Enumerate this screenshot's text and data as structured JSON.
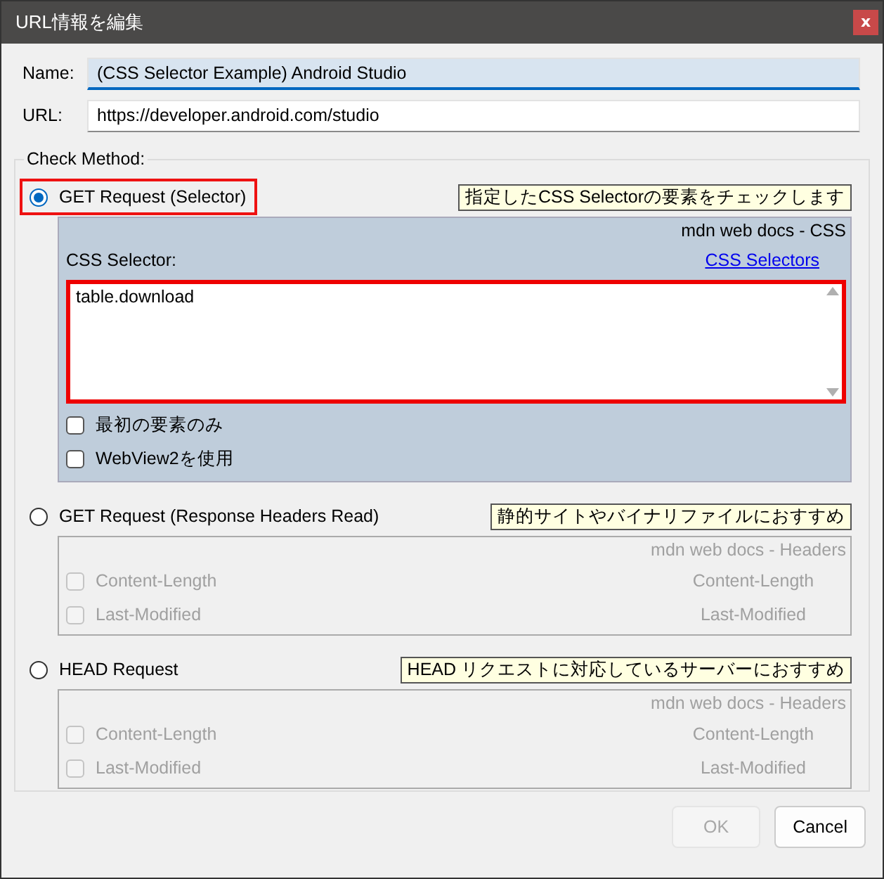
{
  "window": {
    "title": "URL情報を編集",
    "close_button": "x"
  },
  "fields": [
    {
      "label": "Name:",
      "value": "(CSS Selector Example) Android Studio",
      "focused": true
    },
    {
      "label": "URL:",
      "value": "https://developer.android.com/studio",
      "focused": false
    }
  ],
  "check_method": {
    "legend": "Check Method:",
    "methods": [
      {
        "label": "GET Request (Selector)",
        "selected": true,
        "highlighted": true,
        "hint": "指定したCSS Selectorの要素をチェックします",
        "panel": {
          "kind": "selector",
          "enabled": true,
          "caption": "mdn web docs - CSS",
          "selector_label": "CSS Selector:",
          "link": "CSS Selectors",
          "selector": {
            "value": "table.download",
            "highlighted": true
          },
          "options": [
            {
              "label": "最初の要素のみ",
              "checked": false
            },
            {
              "label": "WebView2を使用",
              "checked": false
            }
          ]
        }
      },
      {
        "label": "GET Request (Response Headers Read)",
        "selected": false,
        "highlighted": false,
        "hint": "静的サイトやバイナリファイルにおすすめ",
        "panel": {
          "kind": "headers",
          "enabled": false,
          "caption": "mdn web docs - Headers",
          "options": [
            {
              "label": "Content-Length",
              "checked": false,
              "link": "Content-Length"
            },
            {
              "label": "Last-Modified",
              "checked": false,
              "link": "Last-Modified"
            }
          ]
        }
      },
      {
        "label": "HEAD Request",
        "selected": false,
        "highlighted": false,
        "hint": "HEAD リクエストに対応しているサーバーにおすすめ",
        "panel": {
          "kind": "headers",
          "enabled": false,
          "caption": "mdn web docs - Headers",
          "options": [
            {
              "label": "Content-Length",
              "checked": false,
              "link": "Content-Length"
            },
            {
              "label": "Last-Modified",
              "checked": false,
              "link": "Last-Modified"
            }
          ]
        }
      }
    ]
  },
  "buttons": [
    {
      "label": "OK",
      "disabled": true
    },
    {
      "label": "Cancel",
      "disabled": false
    }
  ]
}
